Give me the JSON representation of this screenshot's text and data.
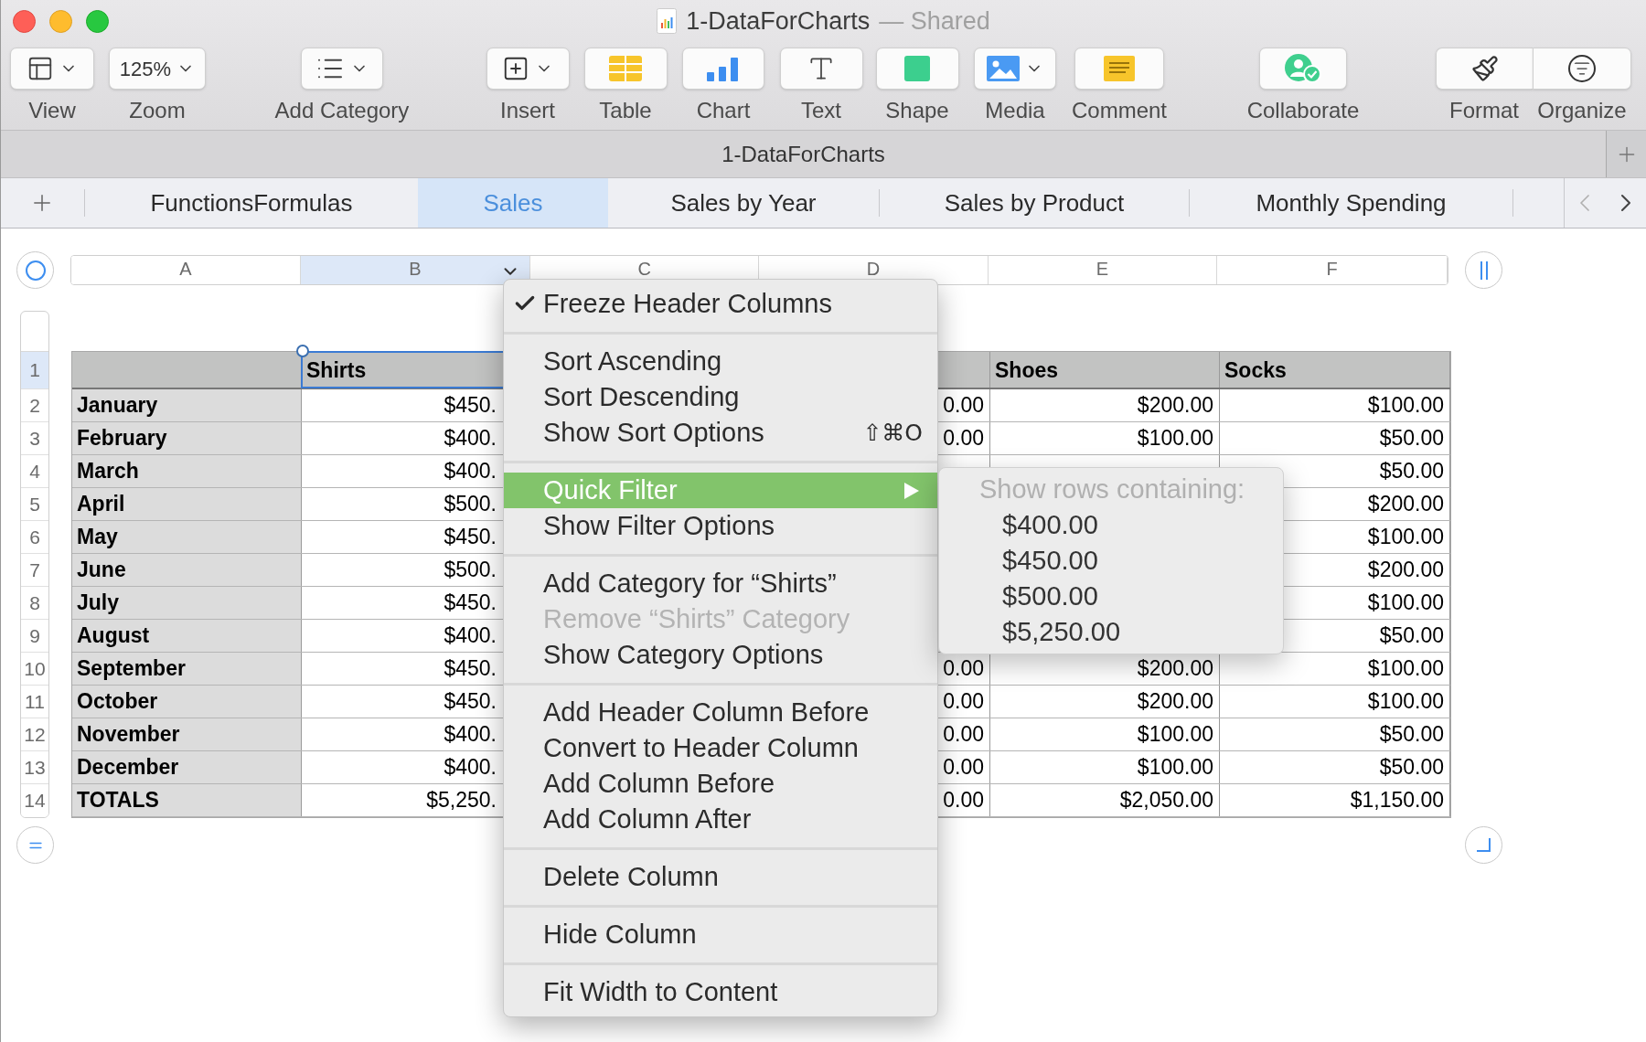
{
  "window": {
    "title": "1-DataForCharts",
    "status": "— Shared"
  },
  "toolbar": [
    {
      "label": "View",
      "kind": "view",
      "dropdown": true
    },
    {
      "label": "Zoom",
      "kind": "zoom",
      "value": "125%",
      "dropdown": true
    },
    {
      "label": "Add Category",
      "kind": "category",
      "dropdown": true
    },
    {
      "label": "Insert",
      "kind": "insert",
      "dropdown": true
    },
    {
      "label": "Table",
      "kind": "table",
      "dropdown": false
    },
    {
      "label": "Chart",
      "kind": "chart",
      "dropdown": false
    },
    {
      "label": "Text",
      "kind": "text",
      "dropdown": false
    },
    {
      "label": "Shape",
      "kind": "shape",
      "dropdown": false
    },
    {
      "label": "Media",
      "kind": "media",
      "dropdown": true
    },
    {
      "label": "Comment",
      "kind": "comment",
      "dropdown": false
    },
    {
      "label": "Collaborate",
      "kind": "collaborate",
      "dropdown": false
    },
    {
      "label": "Format",
      "kind": "format",
      "dropdown": false
    },
    {
      "label": "Organize",
      "kind": "organize",
      "dropdown": false
    }
  ],
  "document_title": "1-DataForCharts",
  "sheet_tabs": [
    {
      "label": "FunctionsFormulas",
      "selected": false
    },
    {
      "label": "Sales",
      "selected": true
    },
    {
      "label": "Sales by Year",
      "selected": false
    },
    {
      "label": "Sales by Product",
      "selected": false
    },
    {
      "label": "Monthly Spending",
      "selected": false
    }
  ],
  "column_headers": [
    {
      "label": "A",
      "selected": false
    },
    {
      "label": "B",
      "selected": true
    },
    {
      "label": "C",
      "selected": false
    },
    {
      "label": "D",
      "selected": false
    },
    {
      "label": "E",
      "selected": false
    },
    {
      "label": "F",
      "selected": false
    }
  ],
  "row_numbers": [
    {
      "label": "1",
      "selected": true
    },
    {
      "label": "2",
      "selected": false
    },
    {
      "label": "3",
      "selected": false
    },
    {
      "label": "4",
      "selected": false
    },
    {
      "label": "5",
      "selected": false
    },
    {
      "label": "6",
      "selected": false
    },
    {
      "label": "7",
      "selected": false
    },
    {
      "label": "8",
      "selected": false
    },
    {
      "label": "9",
      "selected": false
    },
    {
      "label": "10",
      "selected": false
    },
    {
      "label": "11",
      "selected": false
    },
    {
      "label": "12",
      "selected": false
    },
    {
      "label": "13",
      "selected": false
    },
    {
      "label": "14",
      "selected": false
    }
  ],
  "table": {
    "header": {
      "shirts": "Shirts",
      "shoes": "Shoes",
      "socks": "Socks"
    },
    "rows": [
      {
        "label": "January",
        "shirts": "$450.",
        "column_4": "0.00",
        "shoes": "$200.00",
        "socks": "$100.00"
      },
      {
        "label": "February",
        "shirts": "$400.",
        "column_4": "0.00",
        "shoes": "$100.00",
        "socks": "$50.00"
      },
      {
        "label": "March",
        "shirts": "$400.",
        "socks": "$50.00"
      },
      {
        "label": "April",
        "shirts": "$500.",
        "socks": "$200.00"
      },
      {
        "label": "May",
        "shirts": "$450.",
        "socks": "$100.00"
      },
      {
        "label": "June",
        "shirts": "$500.",
        "socks": "$200.00"
      },
      {
        "label": "July",
        "shirts": "$450.",
        "socks": "$100.00"
      },
      {
        "label": "August",
        "shirts": "$400.",
        "socks": "$50.00"
      },
      {
        "label": "September",
        "shirts": "$450.",
        "column_4": "0.00",
        "shoes": "$200.00",
        "socks": "$100.00"
      },
      {
        "label": "October",
        "shirts": "$450.",
        "column_4": "0.00",
        "shoes": "$200.00",
        "socks": "$100.00"
      },
      {
        "label": "November",
        "shirts": "$400.",
        "column_4": "0.00",
        "shoes": "$100.00",
        "socks": "$50.00"
      },
      {
        "label": "December",
        "shirts": "$400.",
        "column_4": "0.00",
        "shoes": "$100.00",
        "socks": "$50.00"
      },
      {
        "label": "TOTALS",
        "shirts": "$5,250.",
        "column_4": "0.00",
        "shoes": "$2,050.00",
        "socks": "$1,150.00"
      }
    ]
  },
  "context_menu": [
    {
      "kind": "item",
      "label": "Freeze Header Columns",
      "checked": true,
      "disabled": false,
      "selected": false,
      "submenu": false
    },
    {
      "kind": "separator"
    },
    {
      "kind": "item",
      "label": "Sort Ascending",
      "checked": false,
      "disabled": false,
      "selected": false,
      "submenu": false
    },
    {
      "kind": "item",
      "label": "Sort Descending",
      "checked": false,
      "disabled": false,
      "selected": false,
      "submenu": false
    },
    {
      "kind": "item",
      "label": "Show Sort Options",
      "shortcut": "⇧⌘O",
      "checked": false,
      "disabled": false,
      "selected": false,
      "submenu": false
    },
    {
      "kind": "separator"
    },
    {
      "kind": "item",
      "label": "Quick Filter",
      "checked": false,
      "disabled": false,
      "selected": true,
      "submenu": true
    },
    {
      "kind": "item",
      "label": "Show Filter Options",
      "checked": false,
      "disabled": false,
      "selected": false,
      "submenu": false
    },
    {
      "kind": "separator"
    },
    {
      "kind": "item",
      "label": "Add Category for “Shirts”",
      "checked": false,
      "disabled": false,
      "selected": false,
      "submenu": false
    },
    {
      "kind": "item",
      "label": "Remove “Shirts” Category",
      "checked": false,
      "disabled": true,
      "selected": false,
      "submenu": false
    },
    {
      "kind": "item",
      "label": "Show Category Options",
      "checked": false,
      "disabled": false,
      "selected": false,
      "submenu": false
    },
    {
      "kind": "separator"
    },
    {
      "kind": "item",
      "label": "Add Header Column Before",
      "checked": false,
      "disabled": false,
      "selected": false,
      "submenu": false
    },
    {
      "kind": "item",
      "label": "Convert to Header Column",
      "checked": false,
      "disabled": false,
      "selected": false,
      "submenu": false
    },
    {
      "kind": "item",
      "label": "Add Column Before",
      "checked": false,
      "disabled": false,
      "selected": false,
      "submenu": false
    },
    {
      "kind": "item",
      "label": "Add Column After",
      "checked": false,
      "disabled": false,
      "selected": false,
      "submenu": false
    },
    {
      "kind": "separator"
    },
    {
      "kind": "item",
      "label": "Delete Column",
      "checked": false,
      "disabled": false,
      "selected": false,
      "submenu": false
    },
    {
      "kind": "separator"
    },
    {
      "kind": "item",
      "label": "Hide Column",
      "checked": false,
      "disabled": false,
      "selected": false,
      "submenu": false
    },
    {
      "kind": "separator"
    },
    {
      "kind": "item",
      "label": "Fit Width to Content",
      "checked": false,
      "disabled": false,
      "selected": false,
      "submenu": false
    }
  ],
  "quick_filter_submenu": {
    "heading": "Show rows containing:",
    "items": [
      "$400.00",
      "$450.00",
      "$500.00",
      "$5,250.00"
    ]
  }
}
